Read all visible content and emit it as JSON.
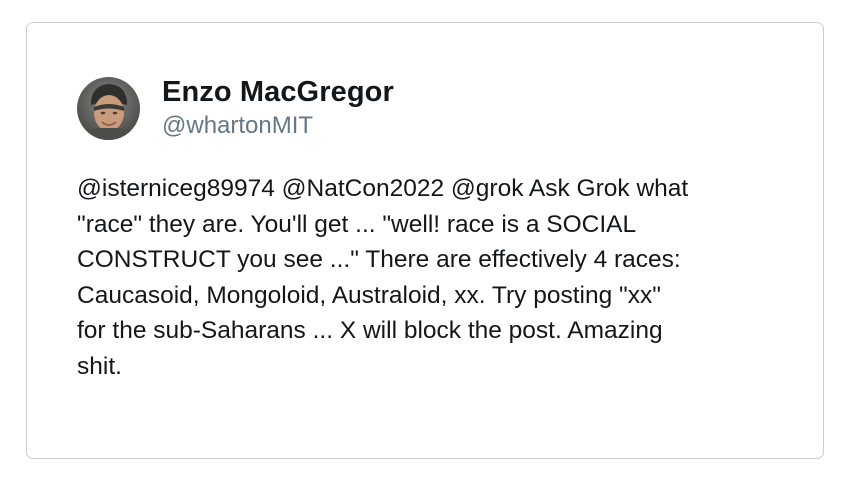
{
  "tweet": {
    "author": {
      "display_name": "Enzo MacGregor",
      "handle": "@whartonMIT",
      "avatar_icon": "profile-photo"
    },
    "text_lines": [
      "@isterniceg89974 @NatCon2022 @grok Ask Grok what",
      "\"race\" they are. You'll get ... \"well! race is a SOCIAL",
      "CONSTRUCT you see ...\" There are effectively 4 races:",
      "Caucasoid, Mongoloid, Australoid, xx. Try posting \"xx\"",
      "for the sub-Saharans ... X will block the post. Amazing",
      "shit."
    ]
  },
  "colors": {
    "text": "#14171a",
    "handle": "#657786",
    "border": "#c9ced3",
    "background": "#ffffff"
  }
}
